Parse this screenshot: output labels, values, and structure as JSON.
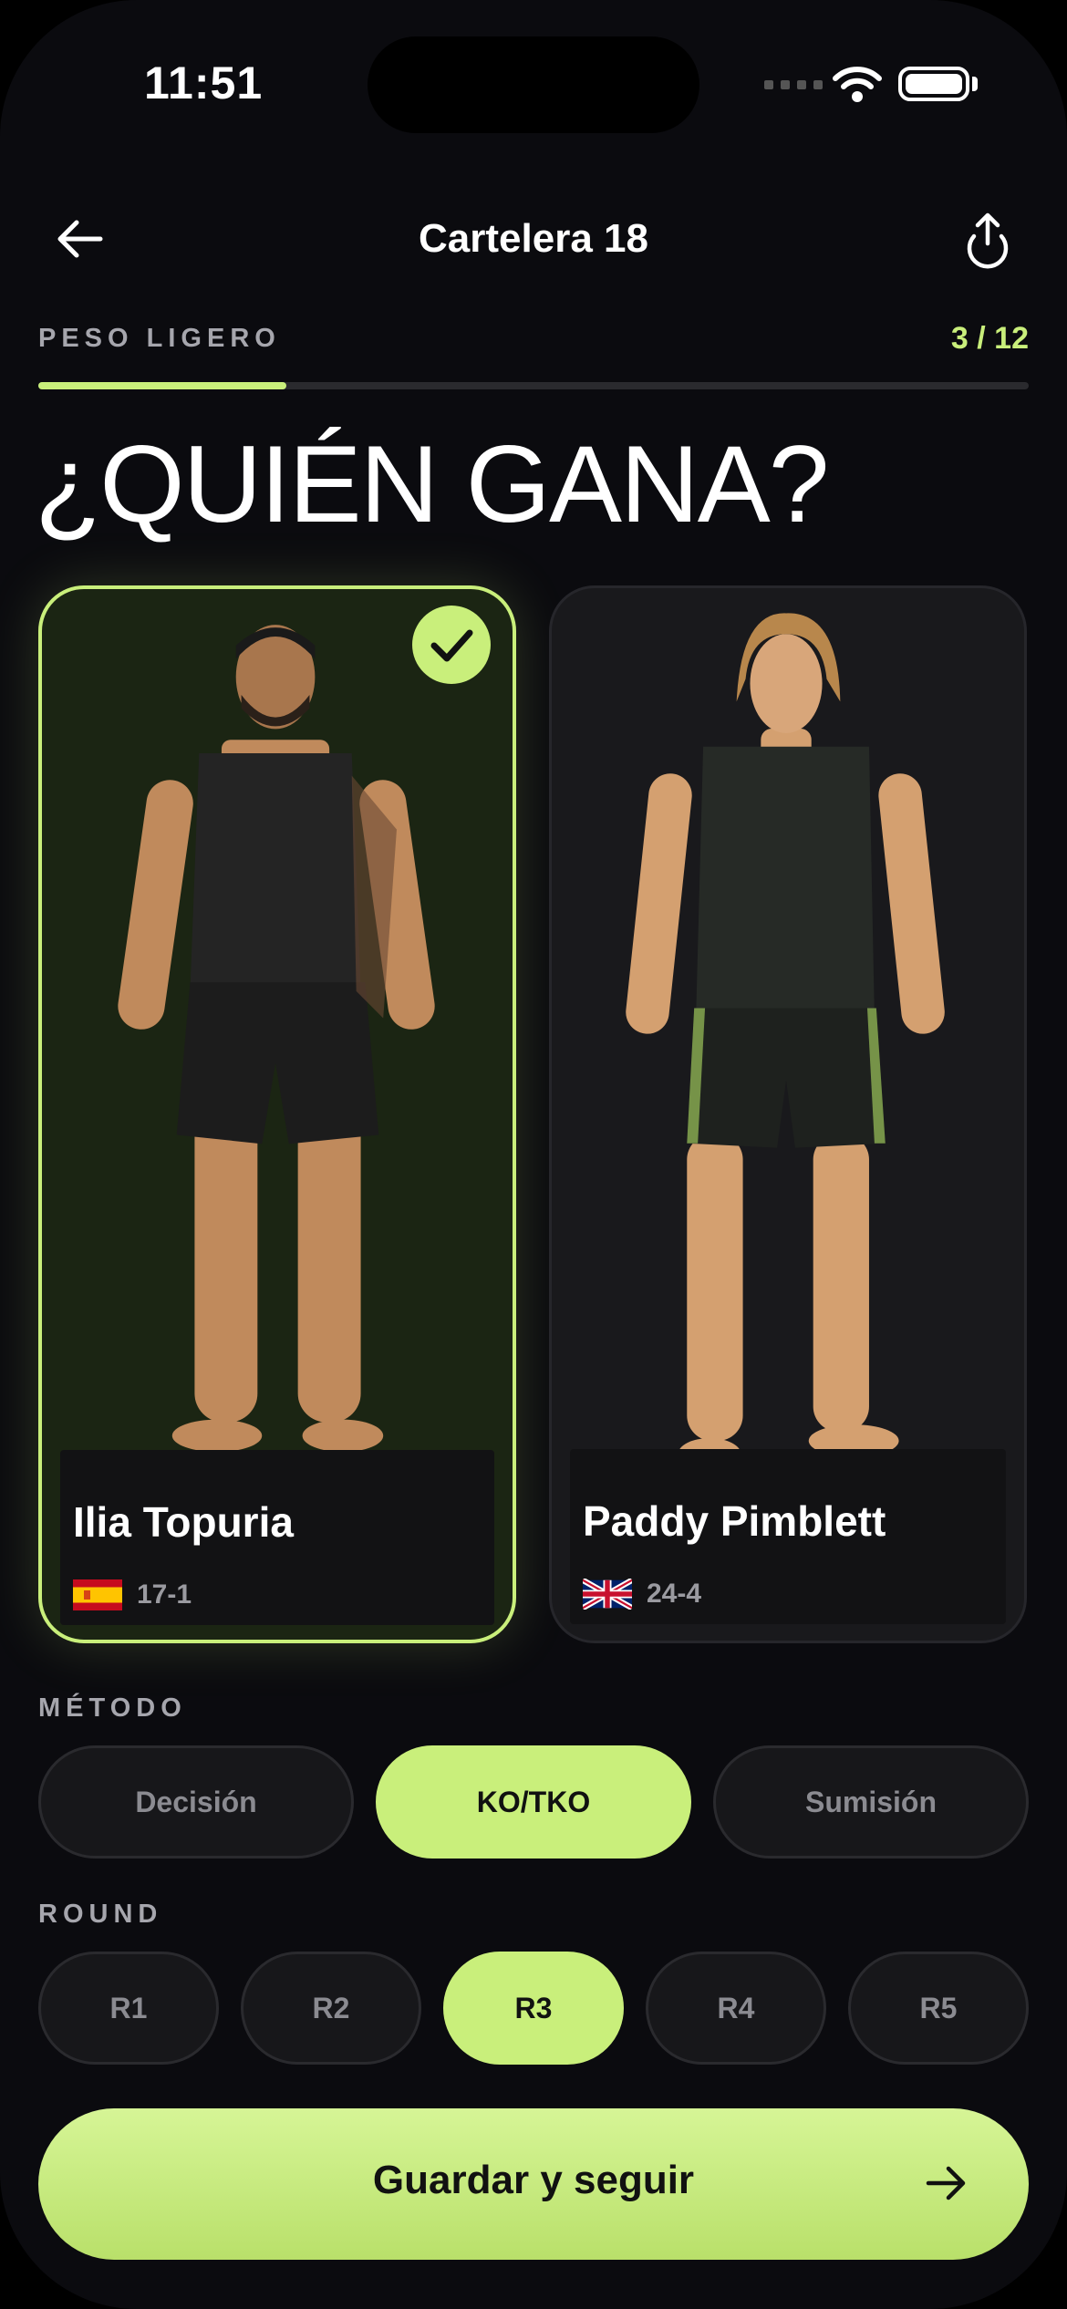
{
  "status_bar": {
    "time": "11:51"
  },
  "nav": {
    "title": "Cartelera 18"
  },
  "fight": {
    "weight_class": "PESO LIGERO",
    "counter": "3 / 12",
    "progress": 0.25
  },
  "headline": "¿QUIÉN GANA?",
  "fighters": [
    {
      "name": "Ilia Topuria",
      "record": "17-1",
      "flag": "spain-flag",
      "selected": true
    },
    {
      "name": "Paddy Pimblett",
      "record": "24-4",
      "flag": "uk-flag",
      "selected": false
    }
  ],
  "method": {
    "label": "MÉTODO",
    "options": [
      "Decisión",
      "KO/TKO",
      "Sumisión"
    ],
    "selected": "KO/TKO"
  },
  "round": {
    "label": "ROUND",
    "options": [
      "R1",
      "R2",
      "R3",
      "R4",
      "R5"
    ],
    "selected": "R3"
  },
  "cta": {
    "label": "Guardar y seguir"
  },
  "colors": {
    "accent": "#c9ef7b",
    "background": "#0b0b0f"
  }
}
